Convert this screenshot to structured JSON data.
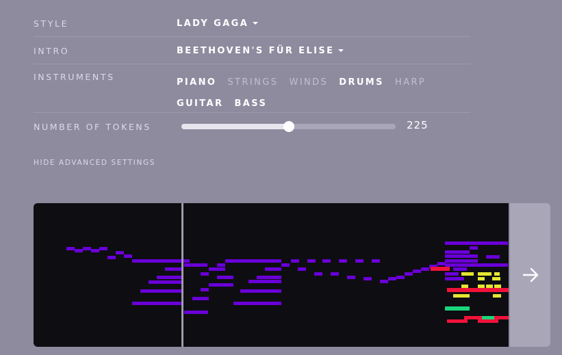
{
  "settings": {
    "style": {
      "label": "STYLE",
      "value": "LADY GAGA"
    },
    "intro": {
      "label": "INTRO",
      "value": "BEETHOVEN'S FÜR ELISE"
    },
    "instruments": {
      "label": "INSTRUMENTS",
      "items": [
        {
          "name": "PIANO",
          "selected": true
        },
        {
          "name": "STRINGS",
          "selected": false
        },
        {
          "name": "WINDS",
          "selected": false
        },
        {
          "name": "DRUMS",
          "selected": true
        },
        {
          "name": "HARP",
          "selected": false
        },
        {
          "name": "GUITAR",
          "selected": true
        },
        {
          "name": "BASS",
          "selected": true
        }
      ]
    },
    "tokens": {
      "label": "NUMBER OF TOKENS",
      "value": "225",
      "fraction": 0.5
    },
    "advanced_toggle": "HIDE ADVANCED SETTINGS"
  },
  "colors": {
    "background": "#8e8b9f",
    "roll_background": "#0e0d12",
    "piano": "#6a00d8",
    "drums": "#e6e630",
    "guitar": "#f0123a",
    "bass": "#19d67a"
  },
  "next_button": {
    "icon": "arrow-right-icon"
  }
}
